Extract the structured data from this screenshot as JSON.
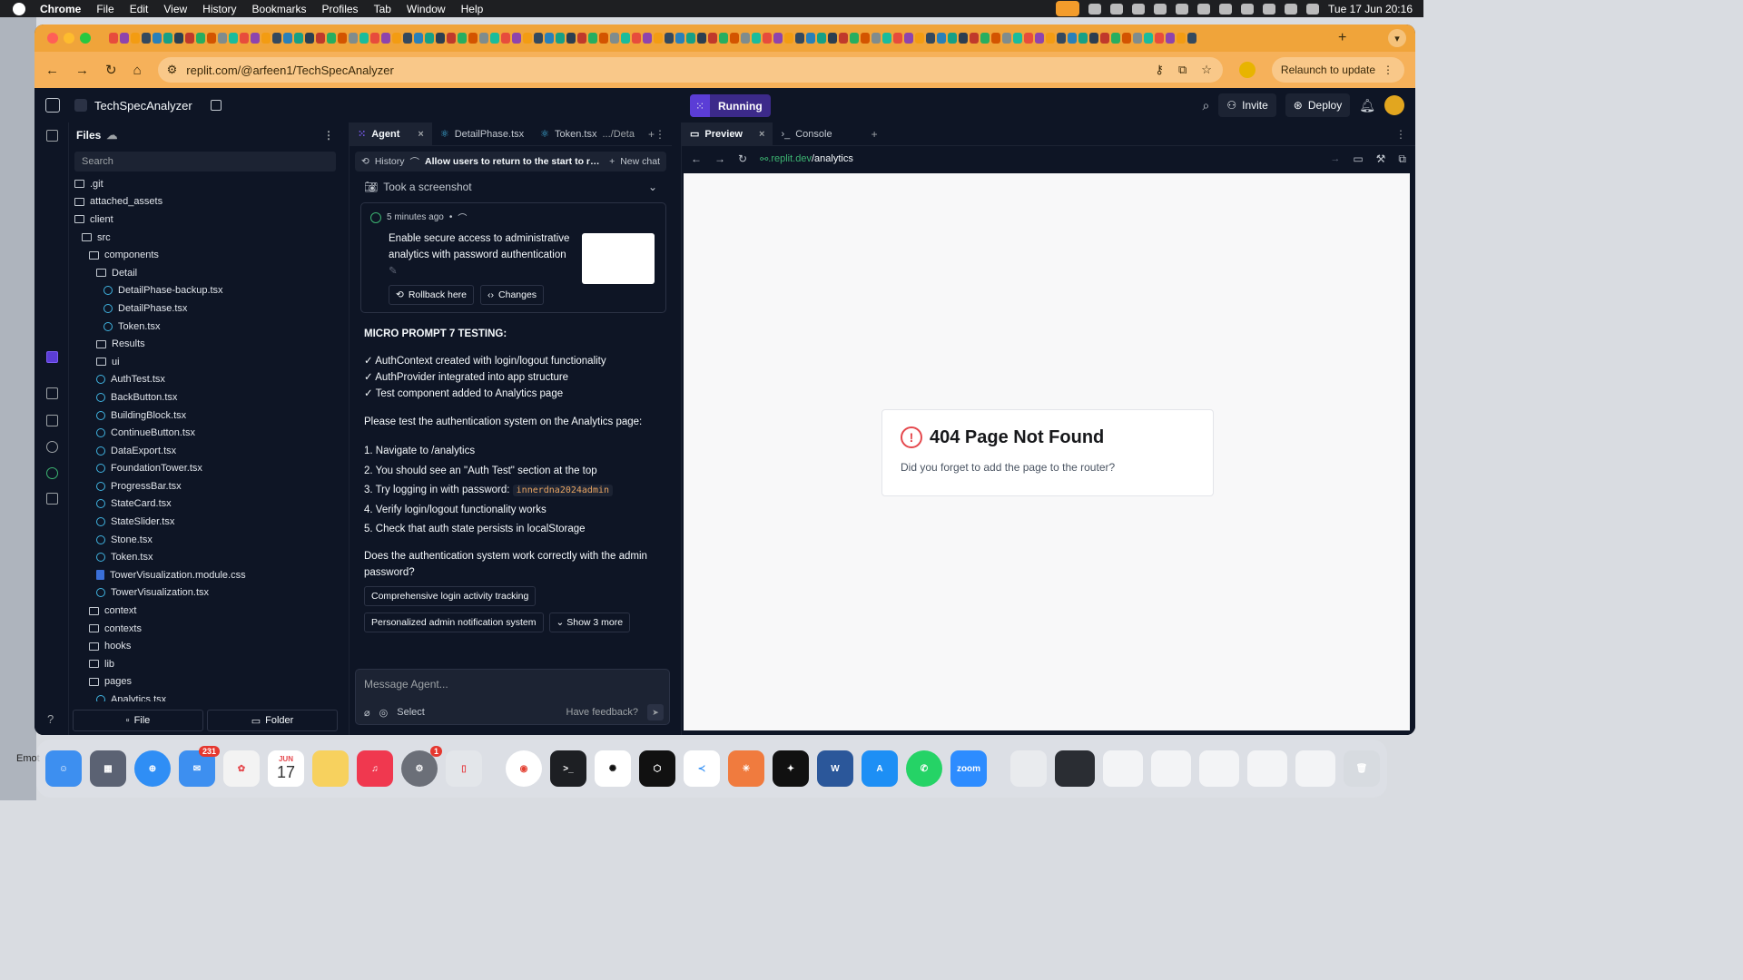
{
  "menubar": {
    "app": "Chrome",
    "items": [
      "File",
      "Edit",
      "View",
      "History",
      "Bookmarks",
      "Profiles",
      "Tab",
      "Window",
      "Help"
    ],
    "clock": "Tue 17 Jun  20:16"
  },
  "browser": {
    "url": "replit.com/@arfeen1/TechSpecAnalyzer",
    "relaunch_label": "Relaunch to update",
    "tab_colors": [
      "#e74c3c",
      "#8e44ad",
      "#f39c12",
      "#34495e",
      "#2980b9",
      "#16a085",
      "#2c3e50",
      "#c0392b",
      "#27ae60",
      "#d35400",
      "#7f8c8d",
      "#1abc9c"
    ]
  },
  "replit": {
    "project": "TechSpecAnalyzer",
    "run_status": "Running",
    "invite_label": "Invite",
    "deploy_label": "Deploy"
  },
  "files": {
    "title": "Files",
    "search_placeholder": "Search",
    "tree": [
      {
        "name": ".git",
        "type": "folder",
        "depth": 0
      },
      {
        "name": "attached_assets",
        "type": "folder",
        "depth": 0
      },
      {
        "name": "client",
        "type": "folder",
        "depth": 0
      },
      {
        "name": "src",
        "type": "folder",
        "depth": 1
      },
      {
        "name": "components",
        "type": "folder",
        "depth": 2
      },
      {
        "name": "Detail",
        "type": "folder",
        "depth": 3
      },
      {
        "name": "DetailPhase-backup.tsx",
        "type": "react",
        "depth": 4
      },
      {
        "name": "DetailPhase.tsx",
        "type": "react",
        "depth": 4
      },
      {
        "name": "Token.tsx",
        "type": "react",
        "depth": 4
      },
      {
        "name": "Results",
        "type": "folder",
        "depth": 3
      },
      {
        "name": "ui",
        "type": "folder",
        "depth": 3
      },
      {
        "name": "AuthTest.tsx",
        "type": "react",
        "depth": 3
      },
      {
        "name": "BackButton.tsx",
        "type": "react",
        "depth": 3
      },
      {
        "name": "BuildingBlock.tsx",
        "type": "react",
        "depth": 3
      },
      {
        "name": "ContinueButton.tsx",
        "type": "react",
        "depth": 3
      },
      {
        "name": "DataExport.tsx",
        "type": "react",
        "depth": 3
      },
      {
        "name": "FoundationTower.tsx",
        "type": "react",
        "depth": 3
      },
      {
        "name": "ProgressBar.tsx",
        "type": "react",
        "depth": 3
      },
      {
        "name": "StateCard.tsx",
        "type": "react",
        "depth": 3
      },
      {
        "name": "StateSlider.tsx",
        "type": "react",
        "depth": 3
      },
      {
        "name": "Stone.tsx",
        "type": "react",
        "depth": 3
      },
      {
        "name": "Token.tsx",
        "type": "react",
        "depth": 3
      },
      {
        "name": "TowerVisualization.module.css",
        "type": "css",
        "depth": 3
      },
      {
        "name": "TowerVisualization.tsx",
        "type": "react",
        "depth": 3
      },
      {
        "name": "context",
        "type": "folder",
        "depth": 2
      },
      {
        "name": "contexts",
        "type": "folder",
        "depth": 2
      },
      {
        "name": "hooks",
        "type": "folder",
        "depth": 2
      },
      {
        "name": "lib",
        "type": "folder",
        "depth": 2
      },
      {
        "name": "pages",
        "type": "folder",
        "depth": 2
      },
      {
        "name": "Analytics.tsx",
        "type": "react",
        "depth": 3
      }
    ],
    "new_file_label": "File",
    "new_folder_label": "Folder"
  },
  "agent": {
    "tabs": [
      "Agent",
      "DetailPhase.tsx",
      "Token.tsx",
      ".../Deta"
    ],
    "history_label": "History",
    "summary": "Allow users to return to the start to reasse...",
    "new_chat_label": "New chat",
    "screenshot_label": "Took a screenshot",
    "checkpoint_time": "5 minutes ago",
    "checkpoint_desc": "Enable secure access to administrative analytics with password authentication",
    "rollback_label": "Rollback here",
    "changes_label": "Changes",
    "heading": "MICRO PROMPT 7 TESTING:",
    "checks": [
      "✓ AuthContext created with login/logout functionality",
      "✓ AuthProvider integrated into app structure",
      "✓ Test component added to Analytics page"
    ],
    "instructions": "Please test the authentication system on the Analytics page:",
    "steps": [
      "1. Navigate to /analytics",
      "2. You should see an \"Auth Test\" section at the top",
      "3. Try logging in with password:",
      "4. Verify login/logout functionality works",
      "5. Check that auth state persists in localStorage"
    ],
    "password": "innerdna2024admin",
    "question": "Does the authentication system work correctly with the admin password?",
    "suggestions": [
      "Comprehensive login activity tracking",
      "Personalized admin notification system"
    ],
    "show_more_label": "Show 3 more",
    "input_placeholder": "Message Agent...",
    "select_label": "Select",
    "feedback_label": "Have feedback?"
  },
  "preview": {
    "tabs": [
      "Preview",
      "Console"
    ],
    "url_domain": ".replit.dev",
    "url_path": "/analytics",
    "error_title": "404 Page Not Found",
    "error_message": "Did you forget to add the page to the router?"
  },
  "dock": {
    "mail_badge": "231",
    "settings_badge": "1",
    "calendar_month": "JUN",
    "calendar_day": "17",
    "zoom_label": "zoom",
    "desktop_label": "Emot"
  }
}
